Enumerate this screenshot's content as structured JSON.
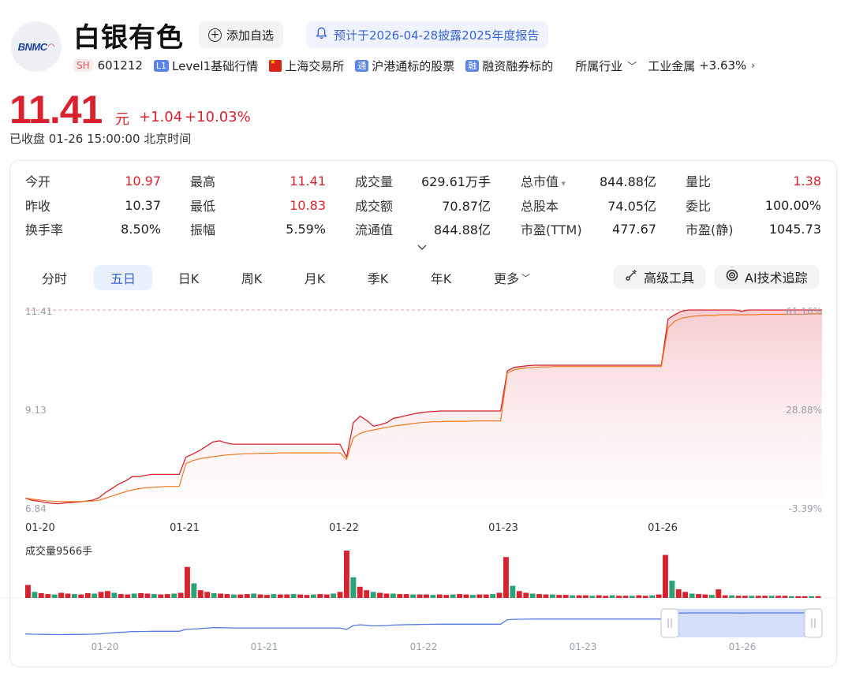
{
  "stock": {
    "name": "白银有色",
    "logo_text": "BNMC",
    "exchange_tag": "SH",
    "code": "601212",
    "tags": [
      {
        "badge": "L1",
        "label": "Level1基础行情"
      },
      {
        "badge": "flag",
        "label": "上海交易所"
      },
      {
        "badge": "通",
        "label": "沪港通标的股票"
      },
      {
        "badge": "融",
        "label": "融资融券标的"
      }
    ],
    "industry_label": "所属行业",
    "industry_name": "工业金属",
    "industry_change": "+3.63%"
  },
  "actions": {
    "add_watch": "添加自选",
    "report_notice": "预计于2026-04-28披露2025年度报告"
  },
  "quote": {
    "price": "11.41",
    "unit": "元",
    "change": "+1.04",
    "change_pct": "+10.03%",
    "status": "已收盘 01-26 15:00:00 北京时间"
  },
  "stats": [
    {
      "label": "今开",
      "value": "10.97",
      "up": true
    },
    {
      "label": "最高",
      "value": "11.41",
      "up": true
    },
    {
      "label": "成交量",
      "value": "629.61万手",
      "up": false
    },
    {
      "label": "总市值",
      "value": "844.88亿",
      "up": false,
      "caret": true
    },
    {
      "label": "量比",
      "value": "1.38",
      "up": true
    },
    {
      "label": "昨收",
      "value": "10.37",
      "up": false
    },
    {
      "label": "最低",
      "value": "10.83",
      "up": true
    },
    {
      "label": "成交额",
      "value": "70.87亿",
      "up": false
    },
    {
      "label": "总股本",
      "value": "74.05亿",
      "up": false
    },
    {
      "label": "委比",
      "value": "100.00%",
      "up": false
    },
    {
      "label": "换手率",
      "value": "8.50%",
      "up": false
    },
    {
      "label": "振幅",
      "value": "5.59%",
      "up": false
    },
    {
      "label": "流通值",
      "value": "844.88亿",
      "up": false
    },
    {
      "label": "市盈(TTM)",
      "value": "477.67",
      "up": false
    },
    {
      "label": "市盈(静)",
      "value": "1045.73",
      "up": false
    }
  ],
  "periods": [
    "分时",
    "五日",
    "日K",
    "周K",
    "月K",
    "季K",
    "年K",
    "更多"
  ],
  "active_period": 1,
  "tools": {
    "advanced": "高级工具",
    "ai": "AI技术追踪"
  },
  "chart_data": {
    "type": "line",
    "title": "",
    "price_axis": [
      "11.41",
      "9.13",
      "6.84"
    ],
    "pct_axis": [
      "61.16%",
      "28.88%",
      "-3.39%"
    ],
    "ylim": [
      6.84,
      11.41
    ],
    "x_labels": [
      "01-20",
      "01-21",
      "01-22",
      "01-23",
      "01-26"
    ],
    "series": [
      {
        "name": "",
        "color": "#d8222f",
        "values": [
          7.05,
          7.0,
          6.98,
          6.95,
          6.93,
          6.92,
          6.94,
          6.95,
          6.96,
          6.98,
          7.0,
          7.06,
          7.18,
          7.28,
          7.38,
          7.45,
          7.55,
          7.55,
          7.58,
          7.6,
          7.6,
          7.6,
          7.6,
          7.6,
          8.0,
          8.07,
          8.15,
          8.25,
          8.35,
          8.38,
          8.33,
          8.3,
          8.3,
          8.3,
          8.3,
          8.3,
          8.3,
          8.3,
          8.3,
          8.3,
          8.3,
          8.3,
          8.3,
          8.3,
          8.3,
          8.3,
          8.3,
          8.3,
          8.0,
          8.8,
          8.95,
          8.85,
          8.72,
          8.75,
          8.8,
          8.9,
          8.93,
          8.97,
          9.0,
          9.03,
          9.05,
          9.06,
          9.07,
          9.07,
          9.07,
          9.07,
          9.07,
          9.07,
          9.07,
          9.07,
          9.07,
          9.07,
          10.0,
          10.08,
          10.1,
          10.12,
          10.13,
          10.13,
          10.13,
          10.13,
          10.13,
          10.13,
          10.13,
          10.13,
          10.13,
          10.13,
          10.13,
          10.13,
          10.13,
          10.13,
          10.13,
          10.13,
          10.13,
          10.13,
          10.13,
          10.13,
          11.2,
          11.3,
          11.38,
          11.41,
          11.41,
          11.41,
          11.41,
          11.41,
          11.41,
          11.41,
          11.41,
          11.38,
          11.41,
          11.41,
          11.41,
          11.41,
          11.41,
          11.41,
          11.41,
          11.41,
          11.41,
          11.41,
          11.41,
          11.41
        ]
      },
      {
        "name": "",
        "color": "#f07a21",
        "values": [
          7.05,
          7.03,
          7.01,
          6.99,
          6.98,
          6.97,
          6.97,
          6.97,
          6.97,
          6.98,
          6.98,
          7.0,
          7.05,
          7.1,
          7.15,
          7.2,
          7.24,
          7.27,
          7.29,
          7.3,
          7.31,
          7.32,
          7.32,
          7.32,
          7.85,
          7.92,
          7.96,
          7.99,
          8.01,
          8.03,
          8.05,
          8.06,
          8.07,
          8.08,
          8.08,
          8.09,
          8.09,
          8.09,
          8.1,
          8.1,
          8.1,
          8.1,
          8.1,
          8.1,
          8.1,
          8.1,
          8.1,
          8.1,
          7.95,
          8.45,
          8.55,
          8.6,
          8.63,
          8.66,
          8.69,
          8.72,
          8.74,
          8.76,
          8.78,
          8.8,
          8.81,
          8.82,
          8.82,
          8.83,
          8.83,
          8.83,
          8.83,
          8.84,
          8.84,
          8.84,
          8.84,
          8.84,
          9.95,
          10.02,
          10.05,
          10.07,
          10.08,
          10.09,
          10.09,
          10.1,
          10.1,
          10.1,
          10.1,
          10.1,
          10.1,
          10.1,
          10.1,
          10.1,
          10.1,
          10.1,
          10.1,
          10.1,
          10.1,
          10.1,
          10.1,
          10.1,
          11.0,
          11.15,
          11.22,
          11.25,
          11.27,
          11.28,
          11.29,
          11.29,
          11.3,
          11.3,
          11.3,
          11.3,
          11.3,
          11.3,
          11.31,
          11.31,
          11.31,
          11.31,
          11.31,
          11.31,
          11.31,
          11.32,
          11.32,
          11.32
        ]
      }
    ],
    "volume_label": "成交量9566手",
    "volume_bars": [
      30,
      14,
      11,
      9,
      8,
      12,
      10,
      9,
      8,
      11,
      10,
      14,
      16,
      12,
      9,
      8,
      10,
      11,
      10,
      9,
      8,
      9,
      10,
      12,
      72,
      34,
      18,
      14,
      11,
      10,
      9,
      8,
      8,
      9,
      10,
      8,
      7,
      9,
      8,
      8,
      9,
      8,
      7,
      8,
      9,
      8,
      10,
      14,
      110,
      48,
      26,
      18,
      14,
      12,
      10,
      10,
      9,
      9,
      8,
      8,
      8,
      7,
      8,
      7,
      8,
      9,
      8,
      7,
      8,
      8,
      9,
      12,
      95,
      28,
      16,
      12,
      10,
      9,
      8,
      8,
      7,
      7,
      6,
      6,
      6,
      5,
      6,
      5,
      6,
      5,
      5,
      5,
      6,
      5,
      6,
      8,
      100,
      40,
      20,
      14,
      10,
      9,
      8,
      7,
      20,
      6,
      6,
      5,
      5,
      5,
      5,
      5,
      5,
      5,
      5,
      4,
      4,
      4,
      4,
      4
    ],
    "overview_labels": [
      "01-20",
      "01-21",
      "01-22",
      "01-23",
      "01-26"
    ]
  }
}
